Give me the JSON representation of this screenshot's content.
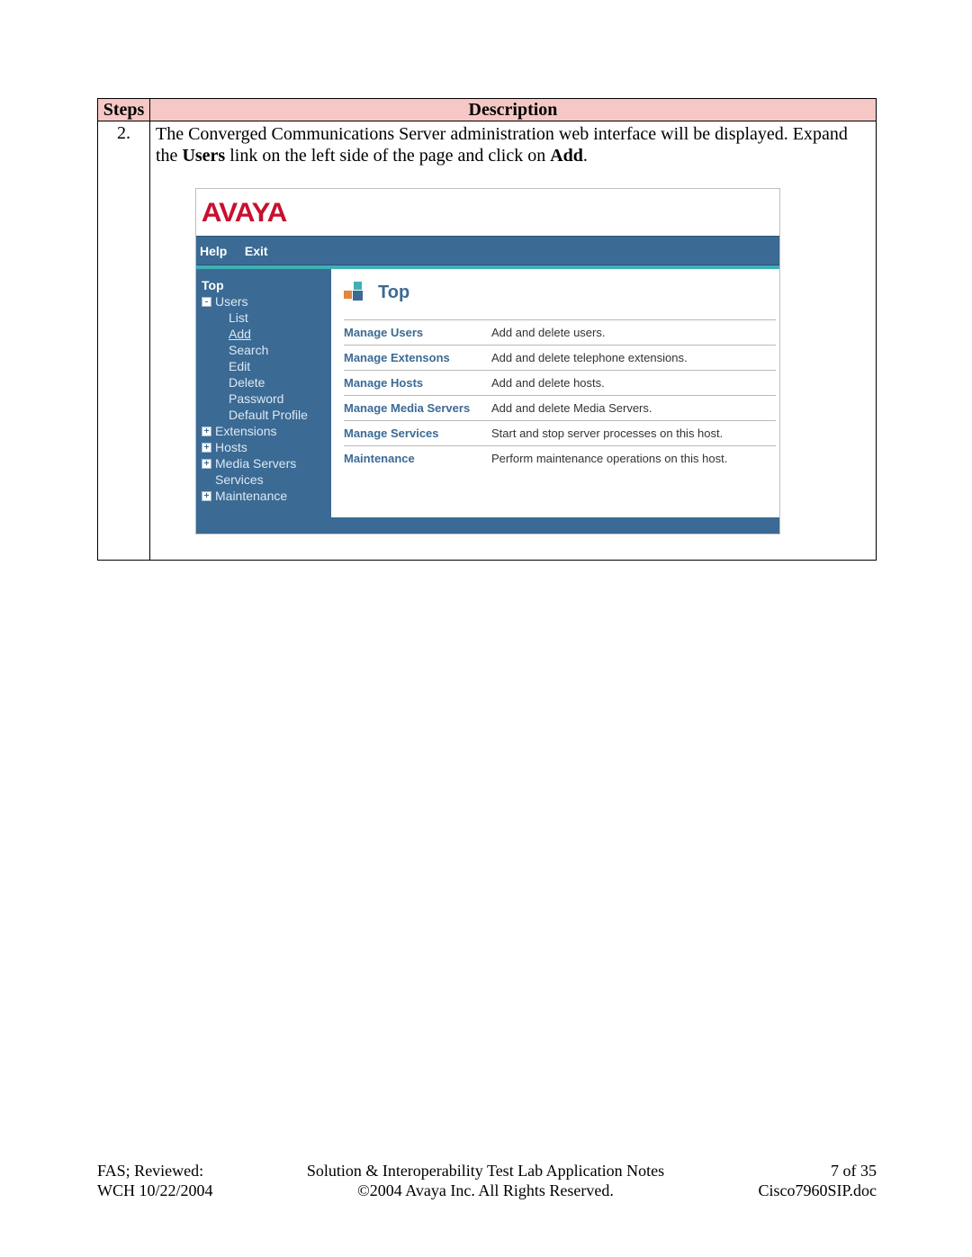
{
  "table": {
    "header_steps": "Steps",
    "header_desc": "Description",
    "step_num": "2.",
    "desc_parts": {
      "t1": "The Converged Communications Server administration web interface will be displayed.  Expand the ",
      "b1": "Users",
      "t2": " link on the left side of the page and click on ",
      "b2": "Add",
      "t3": "."
    }
  },
  "screenshot": {
    "logo": "AVAYA",
    "menu": {
      "help": "Help",
      "exit": "Exit"
    },
    "sidebar": {
      "top": "Top",
      "users": "Users",
      "sub": {
        "list": "List",
        "add": "Add",
        "search": "Search",
        "edit": "Edit",
        "delete": "Delete",
        "password": "Password",
        "default_profile": "Default Profile"
      },
      "extensions": "Extensions",
      "hosts": "Hosts",
      "media_servers": "Media Servers",
      "services": "Services",
      "maintenance": "Maintenance"
    },
    "content": {
      "heading": "Top",
      "rows": [
        {
          "label": "Manage Users",
          "desc": "Add and delete users."
        },
        {
          "label": "Manage Extensons",
          "desc": "Add and delete telephone extensions."
        },
        {
          "label": "Manage Hosts",
          "desc": "Add and delete hosts."
        },
        {
          "label": "Manage Media Servers",
          "desc": "Add and delete Media Servers."
        },
        {
          "label": "Manage Services",
          "desc": "Start and stop server processes on this host."
        },
        {
          "label": "Maintenance",
          "desc": "Perform maintenance operations on this host."
        }
      ]
    }
  },
  "footer": {
    "left1": "FAS; Reviewed:",
    "left2": "WCH 10/22/2004",
    "center1": "Solution & Interoperability Test Lab Application Notes",
    "center2": "©2004 Avaya Inc. All Rights Reserved.",
    "right1": "7 of 35",
    "right2": "Cisco7960SIP.doc"
  }
}
